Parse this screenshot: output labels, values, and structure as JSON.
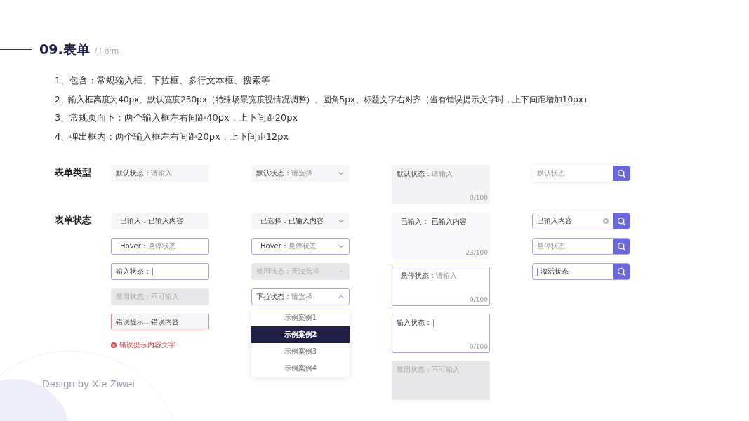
{
  "header": {
    "title": "09.表单",
    "subtitle": "/ Form"
  },
  "notes": [
    "1、包含：常规输入框、下拉框、多行文本框、搜索等",
    "2、输入框高度为40px、默认宽度230px（特殊场景宽度视情况调整）、圆角5px、标题文字右对齐（当有错误提示文字时，上下间距增加10px）",
    "3、常规页面下：两个输入框左右间距40px，上下间距20px",
    "4、弹出框内：两个输入框左右间距20px，上下间距12px"
  ],
  "row_labels": [
    "表单类型",
    "表单状态"
  ],
  "columns": [
    {
      "kind": "input",
      "type": {
        "kind": "default",
        "label": "默认状态：",
        "placeholder": "请输入"
      },
      "states": [
        {
          "kind": "filled",
          "label": "已输入：",
          "value": "已输入内容"
        },
        {
          "kind": "hover",
          "label": "Hover：",
          "placeholder": "悬停状态"
        },
        {
          "kind": "focus",
          "label": "输入状态："
        },
        {
          "kind": "disabled",
          "label": "禁用状态：",
          "placeholder": "不可输入"
        },
        {
          "kind": "error",
          "label": "错误提示：",
          "value": "错误内容",
          "error_message": "错误提示内容文字"
        }
      ]
    },
    {
      "kind": "select",
      "type": {
        "kind": "default",
        "label": "默认状态：",
        "placeholder": "请选择",
        "expanded": false
      },
      "states": [
        {
          "kind": "filled",
          "label": "已选择：",
          "value": "已输入内容",
          "expanded": false
        },
        {
          "kind": "hover",
          "label": "Hover：",
          "placeholder": "悬停状态",
          "expanded": false
        },
        {
          "kind": "disabled",
          "label": "禁用状态：",
          "placeholder": "无法选择",
          "expanded": false
        },
        {
          "kind": "focus",
          "label": "下拉状态：",
          "placeholder": "请选择",
          "expanded": true,
          "options": [
            {
              "label": "示例案例1",
              "selected": false
            },
            {
              "label": "示例案例2",
              "selected": true
            },
            {
              "label": "示例案例3",
              "selected": false
            },
            {
              "label": "示例案例4",
              "selected": false
            }
          ]
        }
      ]
    },
    {
      "kind": "textarea",
      "type": {
        "kind": "default",
        "label": "默认状态：",
        "placeholder": "请输入",
        "counter": "0/100"
      },
      "states": [
        {
          "kind": "filled",
          "label": "已输入：",
          "value": "已输入内容",
          "counter": "23/100"
        },
        {
          "kind": "hover",
          "label": "悬停状态：",
          "placeholder": "请输入",
          "counter": "0/100"
        },
        {
          "kind": "focus",
          "label": "输入状态：",
          "counter": "0/100"
        },
        {
          "kind": "disabled",
          "label": "禁用状态：",
          "placeholder": "不可输入"
        }
      ]
    },
    {
      "kind": "search",
      "type": {
        "kind": "default",
        "placeholder": "默认状态",
        "clear_icon": false
      },
      "states": [
        {
          "kind": "filled",
          "value": "已输入内容",
          "clear_icon": true
        },
        {
          "kind": "hover",
          "placeholder": "悬停状态",
          "clear_icon": false
        },
        {
          "kind": "focus",
          "value": "激活状态",
          "clear_icon": false
        }
      ]
    }
  ],
  "footer": "Design by Xie Ziwei"
}
